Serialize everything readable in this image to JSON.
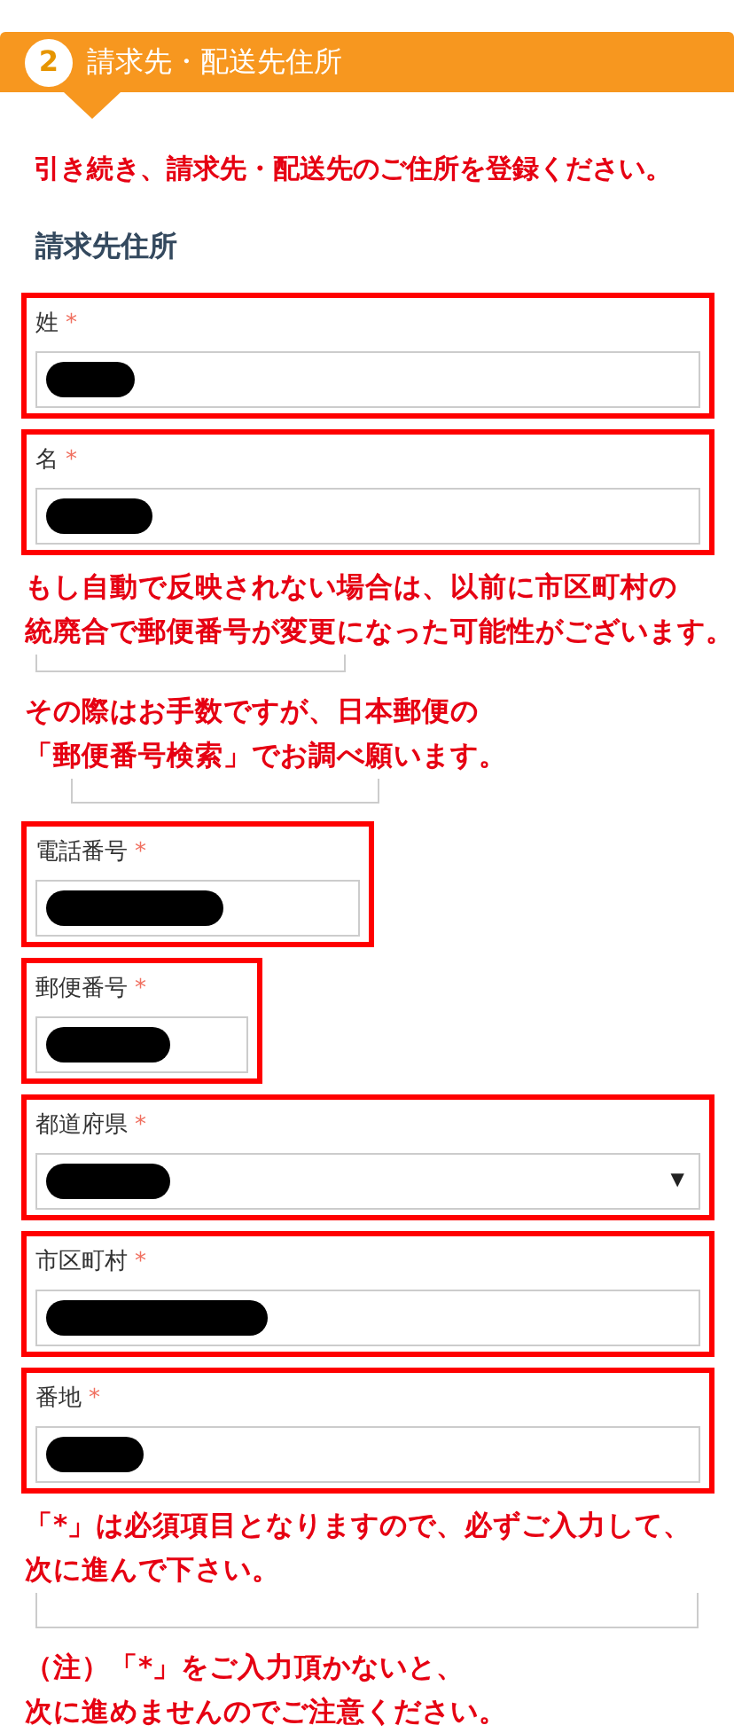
{
  "header": {
    "step": "2",
    "title": "請求先・配送先住所"
  },
  "notice": "引き続き、請求先・配送先のご住所を登録ください。",
  "section_title": "請求先住所",
  "items": [
    {
      "kind": "input",
      "label": "姓",
      "required": "*",
      "highlighted": true,
      "redacted": true
    },
    {
      "kind": "input",
      "label": "名",
      "required": "*",
      "highlighted": true,
      "redacted": true
    },
    {
      "kind": "note",
      "lines": [
        "もし自動で反映されない場合は、以前に市区町村の",
        "統廃合で郵便番号が変更になった可能性がございます。"
      ]
    },
    {
      "kind": "note",
      "lines": [
        "その際はお手数ですが、日本郵便の",
        "「郵便番号検索」でお調べ願います。"
      ]
    },
    {
      "kind": "input",
      "label": "電話番号",
      "required": "*",
      "highlighted": true,
      "redacted": true
    },
    {
      "kind": "input",
      "label": "郵便番号",
      "required": "*",
      "highlighted": true,
      "redacted": true
    },
    {
      "kind": "select",
      "label": "都道府県",
      "required": "*",
      "highlighted": true,
      "redacted": true,
      "caret": "▼"
    },
    {
      "kind": "input",
      "label": "市区町村",
      "required": "*",
      "highlighted": true,
      "redacted": true
    },
    {
      "kind": "input",
      "label": "番地",
      "required": "*",
      "highlighted": true,
      "redacted": true
    },
    {
      "kind": "note",
      "lines": [
        "「*」は必須項目となりますので、必ずご入力して、",
        "次に進んで下さい。"
      ]
    },
    {
      "kind": "note",
      "lines": [
        "（注）「*」をご入力頂かないと、",
        "次に進めませんのでご注意ください。"
      ]
    }
  ]
}
